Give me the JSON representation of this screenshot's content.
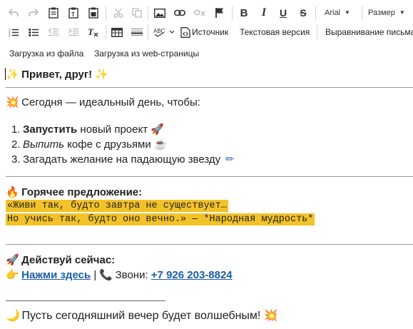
{
  "toolbar": {
    "font_name": "Arial",
    "font_size": "Размер",
    "source_label": "Источник",
    "text_version_label": "Текстовая версия",
    "align_label": "Выравнивание письма",
    "spell_label": "ABC",
    "upload_file_label": "Загрузка из файла",
    "upload_web_label": "Загрузка из web-страницы"
  },
  "content": {
    "greeting_emoji": "✨",
    "greeting": "Привет, друг!",
    "intro_emoji": "💥",
    "intro": "Сегодня — идеальный день, чтобы:",
    "items": [
      {
        "num": "1.",
        "bold": "Запустить",
        "rest": " новый проект",
        "emoji": "🚀"
      },
      {
        "num": "2.",
        "italic": "Выпить",
        "rest": " кофе с друзьями",
        "emoji": "☕"
      },
      {
        "num": "3.",
        "rest": "Загадать желание на падающую звезду",
        "emoji": "✏"
      }
    ],
    "offer_emoji": "🔥",
    "offer_title": "Горячее предложение:",
    "quote_line1": "«Живи так, будто завтра не существует…",
    "quote_line2": "Но учись так, будто оно вечно.» — *Народная мудрость*",
    "action_emoji": "🚀",
    "action_title": "Действуй сейчас:",
    "pointer_emoji": "👉",
    "link_text": "Нажми здесь",
    "separator": "|",
    "phone_emoji": "📞",
    "call_label": "Звони:",
    "phone": "+7 926 203-8824",
    "closing_emoji": "🌙",
    "closing": "Пусть сегодняшний вечер будет волшебным!",
    "closing_end_emoji": "💥"
  }
}
